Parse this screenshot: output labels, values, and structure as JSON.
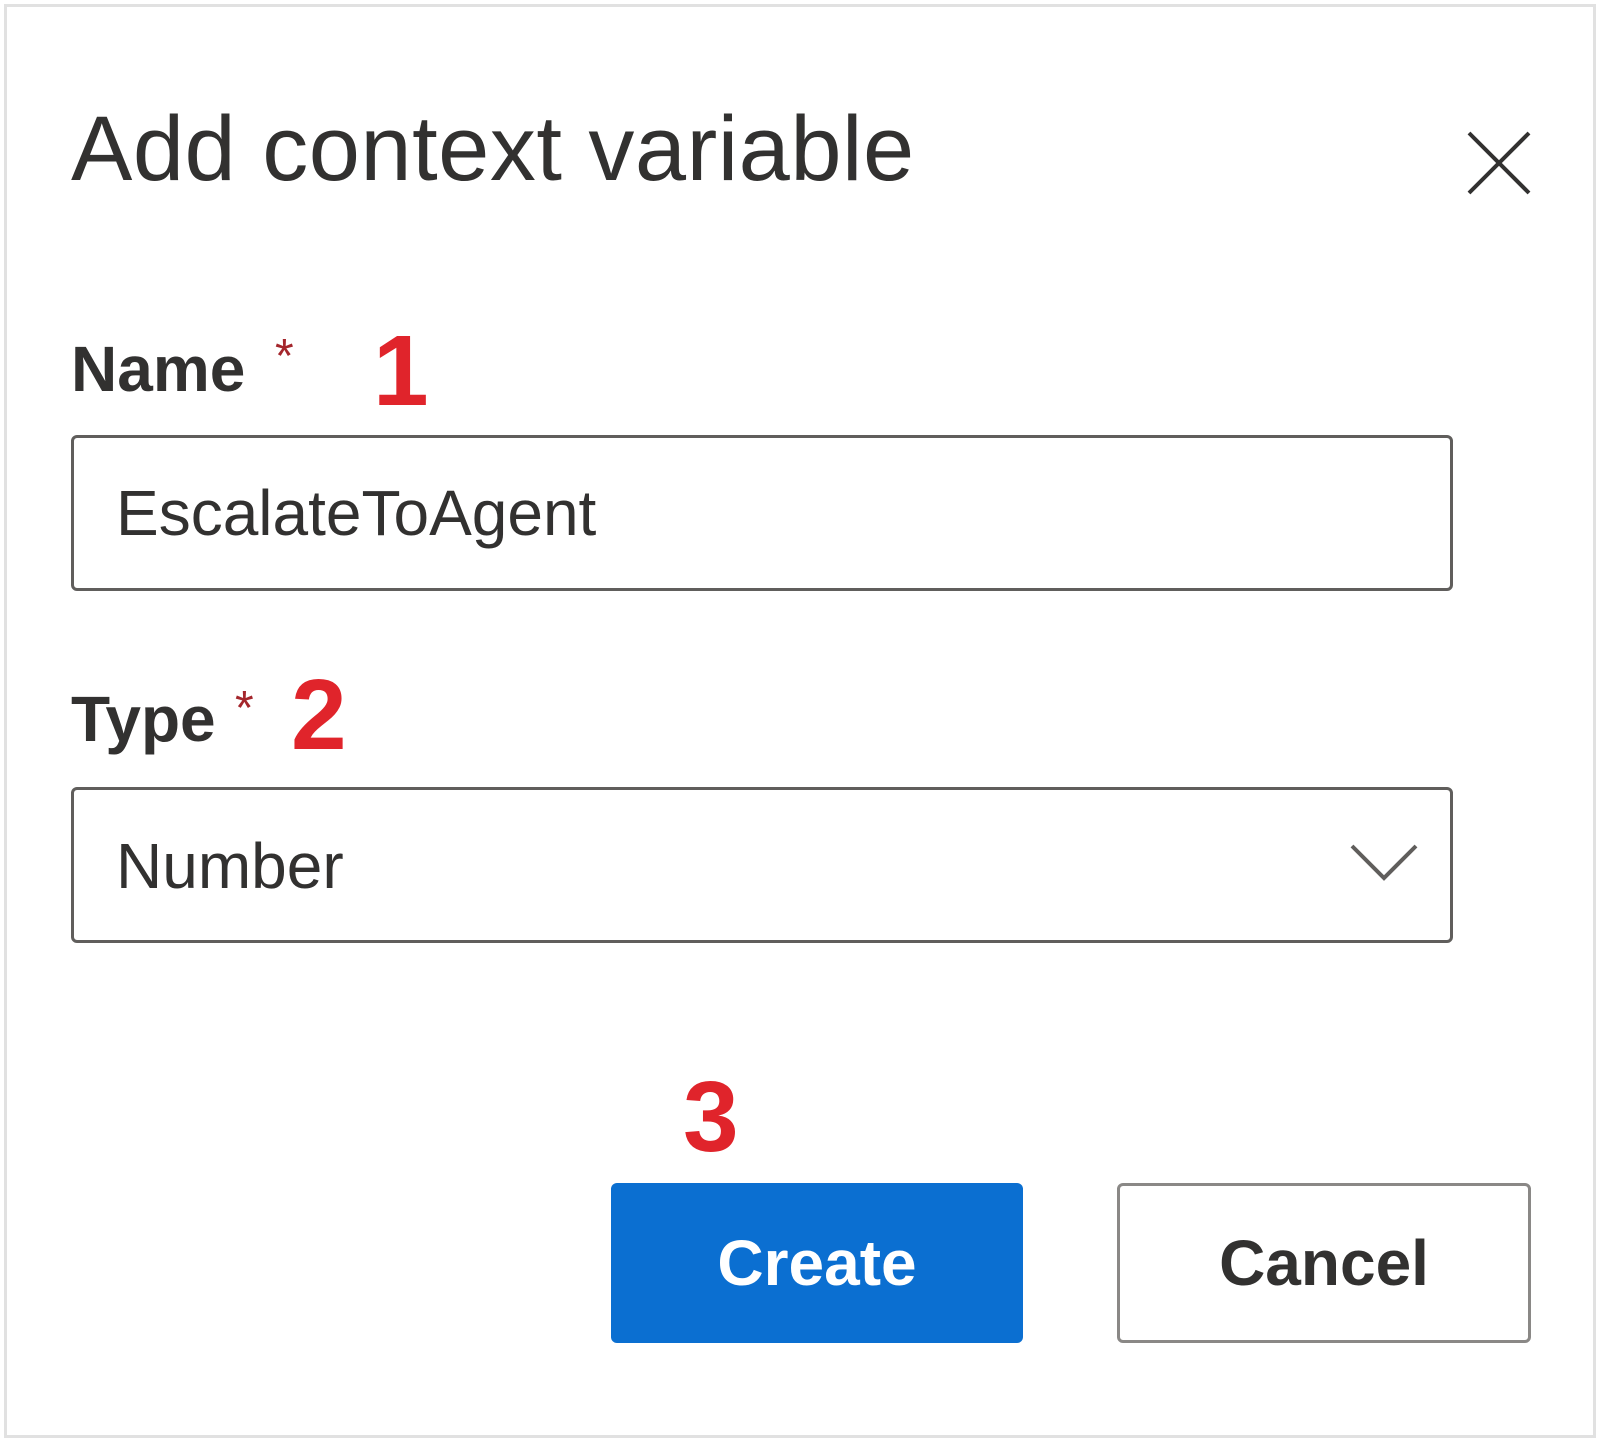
{
  "dialog": {
    "title": "Add context variable",
    "close_icon": "close-icon"
  },
  "name_field": {
    "label": "Name",
    "required_marker": "*",
    "step_number": "1",
    "value": "EscalateToAgent"
  },
  "type_field": {
    "label": "Type",
    "required_marker": "*",
    "step_number": "2",
    "selected_value": "Number",
    "chevron_icon": "chevron-down-icon"
  },
  "actions": {
    "step_number": "3",
    "create_label": "Create",
    "cancel_label": "Cancel"
  },
  "colors": {
    "primary": "#0b6fd1",
    "step_marker": "#e0242b",
    "required": "#a4262c"
  }
}
